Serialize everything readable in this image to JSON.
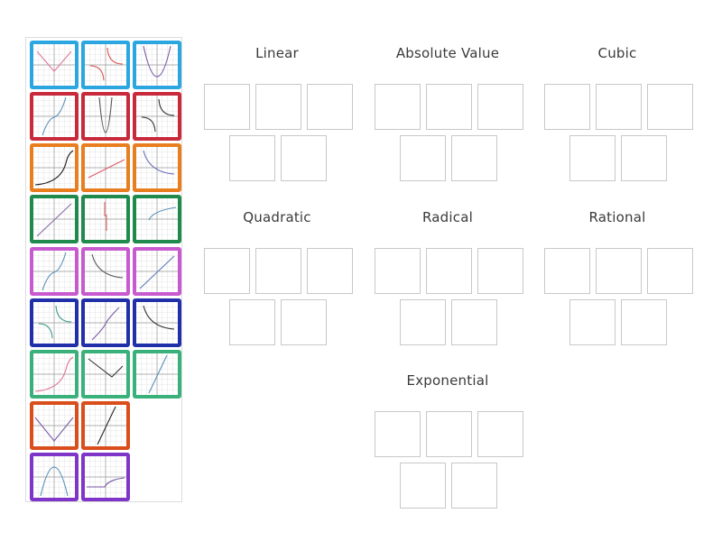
{
  "groups": [
    {
      "title": "Linear",
      "slots": 5
    },
    {
      "title": "Absolute Value",
      "slots": 5
    },
    {
      "title": "Cubic",
      "slots": 5
    },
    {
      "title": "Quadratic",
      "slots": 5
    },
    {
      "title": "Radical",
      "slots": 5
    },
    {
      "title": "Rational",
      "slots": 5
    },
    {
      "title": "Exponential",
      "slots": 5
    }
  ],
  "tiles": [
    {
      "border": "#2ba6e0",
      "curve": "abs",
      "line": "#e07a9a"
    },
    {
      "border": "#2ba6e0",
      "curve": "rational",
      "line": "#d9534f"
    },
    {
      "border": "#2ba6e0",
      "curve": "parabola",
      "line": "#7b5ba8"
    },
    {
      "border": "#c8293b",
      "curve": "cubic",
      "line": "#5a8fb8"
    },
    {
      "border": "#c8293b",
      "curve": "parabola-narrow",
      "line": "#555555"
    },
    {
      "border": "#c8293b",
      "curve": "rational",
      "line": "#333333"
    },
    {
      "border": "#e87e1f",
      "curve": "exp",
      "line": "#222222"
    },
    {
      "border": "#e87e1f",
      "curve": "line-shallow",
      "line": "#e05a6a"
    },
    {
      "border": "#e87e1f",
      "curve": "rational-low",
      "line": "#6a6fb8"
    },
    {
      "border": "#1f8a4c",
      "curve": "line-diag",
      "line": "#8a6aa8"
    },
    {
      "border": "#1f8a4c",
      "curve": "vertical-spike",
      "line": "#e06a6a"
    },
    {
      "border": "#1f8a4c",
      "curve": "sqrt",
      "line": "#5a8fb8"
    },
    {
      "border": "#c85ad0",
      "curve": "cubic",
      "line": "#5a8fb8"
    },
    {
      "border": "#c85ad0",
      "curve": "rational-low",
      "line": "#555555"
    },
    {
      "border": "#c85ad0",
      "curve": "line-diag",
      "line": "#5a7ab8"
    },
    {
      "border": "#2130a8",
      "curve": "rational",
      "line": "#3a9a8a"
    },
    {
      "border": "#2130a8",
      "curve": "cubic-soft",
      "line": "#7b5ba8"
    },
    {
      "border": "#2130a8",
      "curve": "rational-low",
      "line": "#333333"
    },
    {
      "border": "#3ab07a",
      "curve": "exp",
      "line": "#e07a9a"
    },
    {
      "border": "#3ab07a",
      "curve": "abs-shift",
      "line": "#333333"
    },
    {
      "border": "#3ab07a",
      "curve": "line-steep",
      "line": "#5a8fb8"
    },
    {
      "border": "#d94e1a",
      "curve": "abs-wide",
      "line": "#7b5ba8"
    },
    {
      "border": "#d94e1a",
      "curve": "line-steep",
      "line": "#222222"
    },
    {
      "border": "#7f35c8",
      "curve": "parabola-down",
      "line": "#5a8fb8"
    },
    {
      "border": "#7f35c8",
      "curve": "sqrt-step",
      "line": "#7b5ba8"
    }
  ]
}
